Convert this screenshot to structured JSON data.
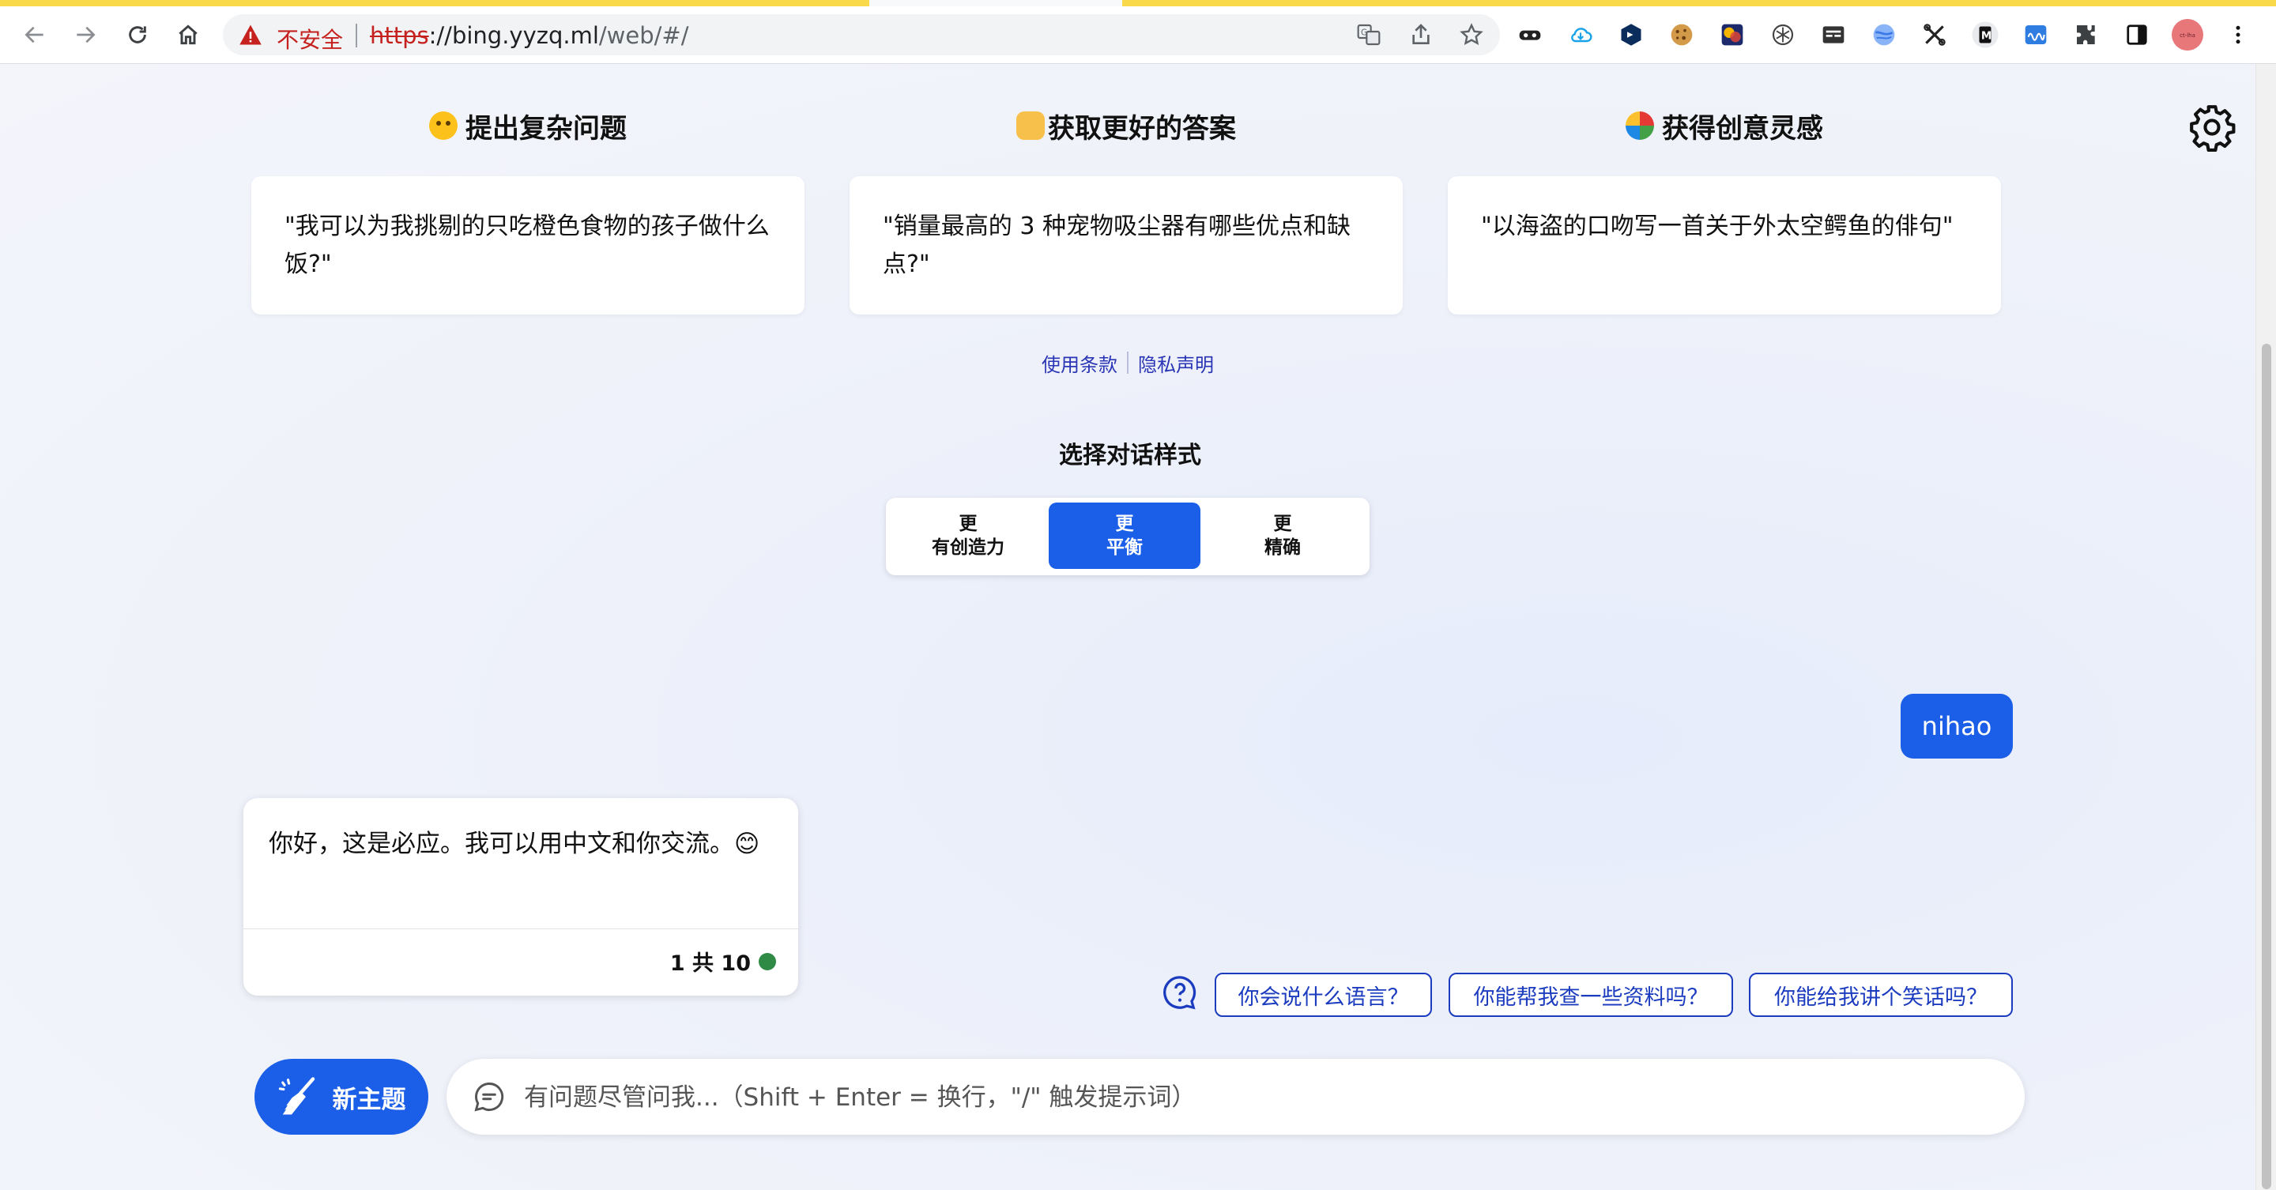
{
  "browser": {
    "security_label": "不安全",
    "url_scheme": "https",
    "url_host": "://bing.yyzq.ml",
    "url_path": "/web/#/",
    "avatar_text": "ct-lha"
  },
  "features": [
    {
      "title": "提出复杂问题",
      "example": "\"我可以为我挑剔的只吃橙色食物的孩子做什么饭?\""
    },
    {
      "title": "获取更好的答案",
      "example": "\"销量最高的 3 种宠物吸尘器有哪些优点和缺点?\""
    },
    {
      "title": "获得创意灵感",
      "example": "\"以海盗的口吻写一首关于外太空鳄鱼的俳句\""
    }
  ],
  "footer": {
    "terms": "使用条款",
    "privacy": "隐私声明"
  },
  "conversation_style": {
    "title": "选择对话样式",
    "options": [
      {
        "line1": "更",
        "line2": "有创造力",
        "selected": false
      },
      {
        "line1": "更",
        "line2": "平衡",
        "selected": true
      },
      {
        "line1": "更",
        "line2": "精确",
        "selected": false
      }
    ]
  },
  "chat": {
    "user_message": "nihao",
    "bot_message": "你好，这是必应。我可以用中文和你交流。😊",
    "turn_counter": "1 共 10"
  },
  "suggestions": [
    "你会说什么语言？",
    "你能帮我查一些资料吗？",
    "你能给我讲个笑话吗？"
  ],
  "composer": {
    "new_topic_label": "新主题",
    "placeholder": "有问题尽管问我...（Shift + Enter = 换行，\"/\" 触发提示词）"
  },
  "colors": {
    "accent": "#1b5ee8",
    "suggestion_border": "#1c3cbf",
    "status_dot": "#2f8a45"
  }
}
